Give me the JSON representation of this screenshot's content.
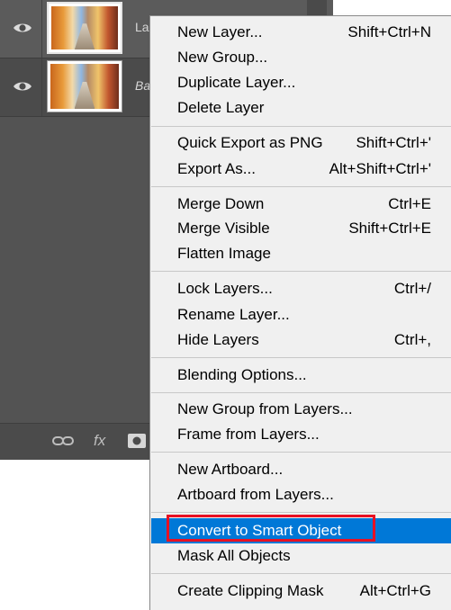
{
  "layers_panel": {
    "layers": [
      {
        "name": "La",
        "selected": true,
        "visible": true,
        "italic": false
      },
      {
        "name": "Ba",
        "selected": false,
        "visible": true,
        "italic": true
      }
    ],
    "bottom_icons": [
      "link-icon",
      "fx-icon",
      "mask-icon"
    ],
    "fx_label": "fx"
  },
  "menu": {
    "items": [
      {
        "label": "New Layer...",
        "shortcut": "Shift+Ctrl+N"
      },
      {
        "label": "New Group...",
        "shortcut": ""
      },
      {
        "label": "Duplicate Layer...",
        "shortcut": ""
      },
      {
        "label": "Delete Layer",
        "shortcut": ""
      },
      {
        "label": "Quick Export as PNG",
        "shortcut": "Shift+Ctrl+'"
      },
      {
        "label": "Export As...",
        "shortcut": "Alt+Shift+Ctrl+'"
      },
      {
        "label": "Merge Down",
        "shortcut": "Ctrl+E"
      },
      {
        "label": "Merge Visible",
        "shortcut": "Shift+Ctrl+E"
      },
      {
        "label": "Flatten Image",
        "shortcut": ""
      },
      {
        "label": "Lock Layers...",
        "shortcut": "Ctrl+/"
      },
      {
        "label": "Rename Layer...",
        "shortcut": ""
      },
      {
        "label": "Hide Layers",
        "shortcut": "Ctrl+,"
      },
      {
        "label": "Blending Options...",
        "shortcut": ""
      },
      {
        "label": "New Group from Layers...",
        "shortcut": ""
      },
      {
        "label": "Frame from Layers...",
        "shortcut": ""
      },
      {
        "label": "New Artboard...",
        "shortcut": ""
      },
      {
        "label": "Artboard from Layers...",
        "shortcut": ""
      },
      {
        "label": "Convert to Smart Object",
        "shortcut": "",
        "highlighted": true
      },
      {
        "label": "Mask All Objects",
        "shortcut": ""
      },
      {
        "label": "Create Clipping Mask",
        "shortcut": "Alt+Ctrl+G"
      }
    ]
  },
  "colors": {
    "highlight": "#0078d7",
    "callout_border": "#e81123"
  }
}
